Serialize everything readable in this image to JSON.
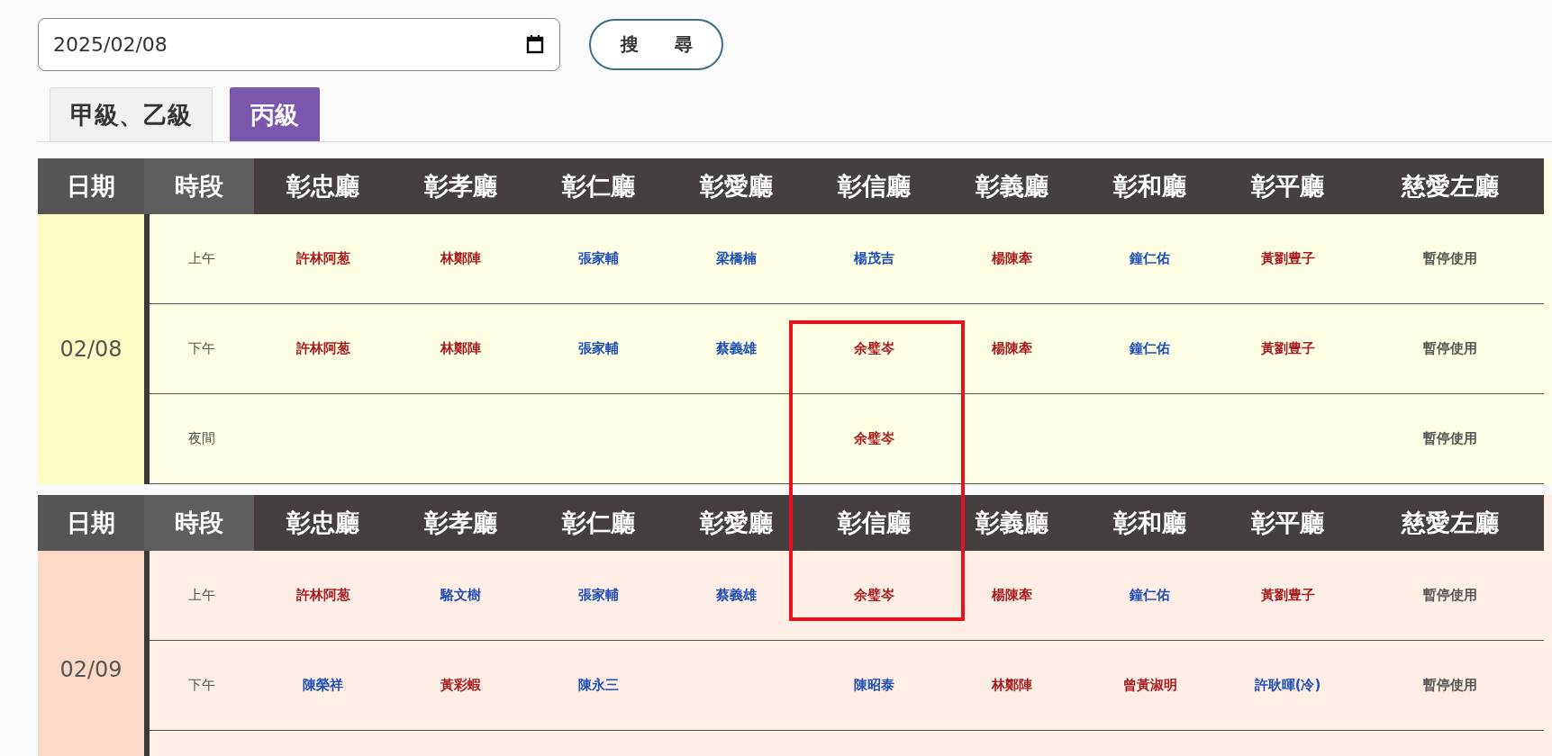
{
  "date_field": {
    "value": "2025/02/08"
  },
  "search_button": {
    "label": "搜　　尋"
  },
  "tabs": [
    {
      "label": "甲級、乙級",
      "selected": false
    },
    {
      "label": "丙級",
      "selected": true
    }
  ],
  "days": [
    {
      "date": "02/08",
      "color": "#fdfcc2",
      "columns": [
        "日期",
        "時段",
        "彰忠廳",
        "彰孝廳",
        "彰仁廳",
        "彰愛廳",
        "彰信廳",
        "彰義廳",
        "彰和廳",
        "彰平廳",
        "慈愛左廳"
      ],
      "slots": [
        {
          "label": "上午",
          "cells": [
            {
              "text": "許林阿葱",
              "color": "#a81c1c"
            },
            {
              "text": "林鄭陣",
              "color": "#a81c1c"
            },
            {
              "text": "張家輔",
              "color": "#1f4fb5"
            },
            {
              "text": "梁橋楠",
              "color": "#1f4fb5"
            },
            {
              "text": "楊茂吉",
              "color": "#1f4fb5"
            },
            {
              "text": "楊陳牽",
              "color": "#a81c1c"
            },
            {
              "text": "鐘仁佑",
              "color": "#1f4fb5"
            },
            {
              "text": "黃劉豊子",
              "color": "#a81c1c"
            },
            {
              "text": "暫停使用",
              "color": "#555555"
            }
          ]
        },
        {
          "label": "下午",
          "cells": [
            {
              "text": "許林阿葱",
              "color": "#a81c1c"
            },
            {
              "text": "林鄭陣",
              "color": "#a81c1c"
            },
            {
              "text": "張家輔",
              "color": "#1f4fb5"
            },
            {
              "text": "蔡義雄",
              "color": "#1f4fb5"
            },
            {
              "text": "余璧岑",
              "color": "#a81c1c"
            },
            {
              "text": "楊陳牽",
              "color": "#a81c1c"
            },
            {
              "text": "鐘仁佑",
              "color": "#1f4fb5"
            },
            {
              "text": "黃劉豊子",
              "color": "#a81c1c"
            },
            {
              "text": "暫停使用",
              "color": "#555555"
            }
          ]
        },
        {
          "label": "夜間",
          "cells": [
            null,
            null,
            null,
            null,
            {
              "text": "余璧岑",
              "color": "#a81c1c"
            },
            null,
            null,
            null,
            {
              "text": "暫停使用",
              "color": "#555555"
            }
          ]
        }
      ]
    },
    {
      "date": "02/09",
      "color": "#fcd9c7",
      "columns": [
        "日期",
        "時段",
        "彰忠廳",
        "彰孝廳",
        "彰仁廳",
        "彰愛廳",
        "彰信廳",
        "彰義廳",
        "彰和廳",
        "彰平廳",
        "慈愛左廳"
      ],
      "slots": [
        {
          "label": "上午",
          "cells": [
            {
              "text": "許林阿葱",
              "color": "#a81c1c"
            },
            {
              "text": "駱文樹",
              "color": "#1f4fb5"
            },
            {
              "text": "張家輔",
              "color": "#1f4fb5"
            },
            {
              "text": "蔡義雄",
              "color": "#1f4fb5"
            },
            {
              "text": "余璧岑",
              "color": "#a81c1c"
            },
            {
              "text": "楊陳牽",
              "color": "#a81c1c"
            },
            {
              "text": "鐘仁佑",
              "color": "#1f4fb5"
            },
            {
              "text": "黃劉豊子",
              "color": "#a81c1c"
            },
            {
              "text": "暫停使用",
              "color": "#555555"
            }
          ]
        },
        {
          "label": "下午",
          "cells": [
            {
              "text": "陳榮祥",
              "color": "#1f4fb5"
            },
            {
              "text": "黃彩蝦",
              "color": "#a81c1c"
            },
            {
              "text": "陳永三",
              "color": "#1f4fb5"
            },
            null,
            {
              "text": "陳昭泰",
              "color": "#1f4fb5"
            },
            {
              "text": "林鄭陣",
              "color": "#a81c1c"
            },
            {
              "text": "曾黃淑明",
              "color": "#a81c1c"
            },
            {
              "text": "許耿暉(冷)",
              "color": "#1f4fb5"
            },
            {
              "text": "暫停使用",
              "color": "#555555"
            }
          ]
        }
      ]
    }
  ]
}
